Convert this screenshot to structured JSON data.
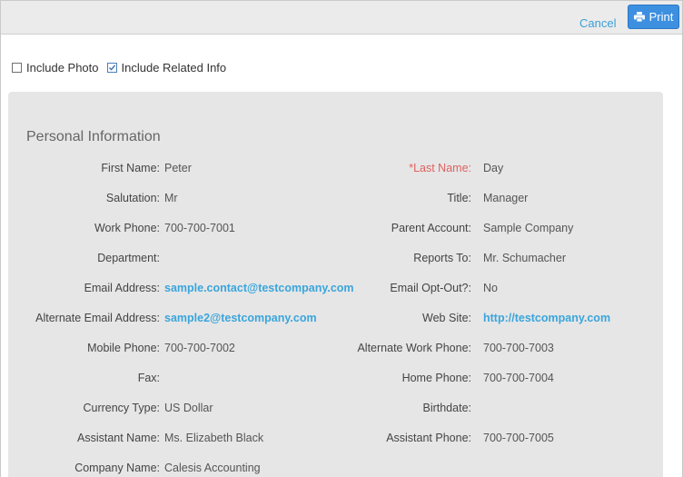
{
  "toolbar": {
    "cancel_label": "Cancel",
    "print_label": "Print"
  },
  "options": {
    "include_photo": {
      "label": "Include Photo",
      "checked": false
    },
    "include_related": {
      "label": "Include Related Info",
      "checked": true
    }
  },
  "section": {
    "title": "Personal Information"
  },
  "fields": {
    "first_name": {
      "label": "First Name:",
      "value": "Peter"
    },
    "last_name": {
      "label": "*Last Name:",
      "value": "Day"
    },
    "salutation": {
      "label": "Salutation:",
      "value": "Mr"
    },
    "title": {
      "label": "Title:",
      "value": "Manager"
    },
    "work_phone": {
      "label": "Work Phone:",
      "value": "700-700-7001"
    },
    "parent_account": {
      "label": "Parent Account:",
      "value": "Sample Company"
    },
    "department": {
      "label": "Department:",
      "value": ""
    },
    "reports_to": {
      "label": "Reports To:",
      "value": "Mr. Schumacher"
    },
    "email": {
      "label": "Email Address:",
      "value": "sample.contact@testcompany.com"
    },
    "email_opt_out": {
      "label": "Email Opt-Out?:",
      "value": "No"
    },
    "alt_email": {
      "label": "Alternate Email Address:",
      "value": "sample2@testcompany.com"
    },
    "web_site": {
      "label": "Web Site:",
      "value": "http://testcompany.com"
    },
    "mobile_phone": {
      "label": "Mobile Phone:",
      "value": "700-700-7002"
    },
    "alt_work_phone": {
      "label": "Alternate Work Phone:",
      "value": "700-700-7003"
    },
    "fax": {
      "label": "Fax:",
      "value": ""
    },
    "home_phone": {
      "label": "Home Phone:",
      "value": "700-700-7004"
    },
    "currency_type": {
      "label": "Currency Type:",
      "value": "US Dollar"
    },
    "birthdate": {
      "label": "Birthdate:",
      "value": ""
    },
    "assistant_name": {
      "label": "Assistant Name:",
      "value": "Ms. Elizabeth Black"
    },
    "assistant_phone": {
      "label": "Assistant Phone:",
      "value": "700-700-7005"
    },
    "company_name": {
      "label": "Company Name:",
      "value": "Calesis Accounting"
    }
  },
  "colors": {
    "accent": "#3d8fe0",
    "link": "#3aa5dc",
    "required": "#e06060",
    "panel": "#e6e6e6"
  }
}
